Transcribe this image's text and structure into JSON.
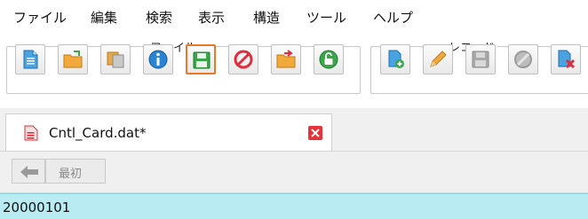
{
  "menu": [
    "ファイル",
    "編集",
    "検索",
    "表示",
    "構造",
    "ツール",
    "ヘルプ"
  ],
  "toolbar": {
    "file_group_title": "ファイル",
    "record_group_title": "レコード",
    "file_buttons": [
      "new-document",
      "open-folder",
      "copy",
      "info",
      "save",
      "cancel",
      "export-folder",
      "unlock"
    ],
    "record_buttons": [
      "add-record",
      "edit-record",
      "save-record",
      "delete-disabled",
      "remove-record"
    ],
    "selected_button": "save"
  },
  "tab": {
    "label": "Cntl_Card.dat*"
  },
  "nav": {
    "first_label": "最初"
  },
  "record": {
    "value": "20000101"
  },
  "colors": {
    "accent": "#e8782a",
    "record_bg": "#b9ebf3",
    "close_red": "#e8323a"
  }
}
